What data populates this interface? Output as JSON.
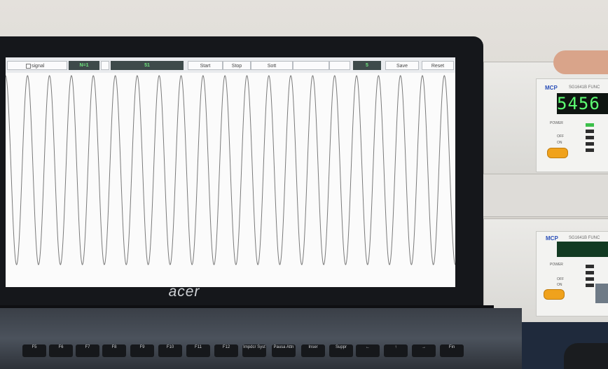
{
  "scene": {
    "laptop_brand": "acer"
  },
  "software": {
    "checkbox_label": "signal",
    "n_label": "N=1",
    "field_value": "51",
    "start_label": "Start",
    "stop_label": "Stop",
    "button3_label": "Sott",
    "count_value": "5",
    "save_label": "Save",
    "reset_label": "Reset"
  },
  "instrument_top": {
    "brand": "MCP",
    "model": "SG1641B FUNC",
    "display_value": "5456",
    "power_label": "POWER",
    "off_label": "OFF",
    "on_label": "ON"
  },
  "instrument_bottom": {
    "brand": "MCP",
    "model": "SG1641B FUNC",
    "power_label": "POWER",
    "off_label": "OFF",
    "on_label": "ON"
  },
  "keyboard": {
    "keys": [
      "F5",
      "F6",
      "F7",
      "F8",
      "F9",
      "F10",
      "F11",
      "F12",
      "Impdcr Syst",
      "Pausa Attn",
      "Inser",
      "Suppr",
      "←",
      "↑",
      "→",
      "Fin"
    ]
  },
  "waveform": {
    "cycles": 20.5,
    "color": "#7a7a7a"
  },
  "colors": {
    "screen_bg": "#fbfbfb",
    "display_green": "#5dff73",
    "power_button": "#f0a21c"
  }
}
